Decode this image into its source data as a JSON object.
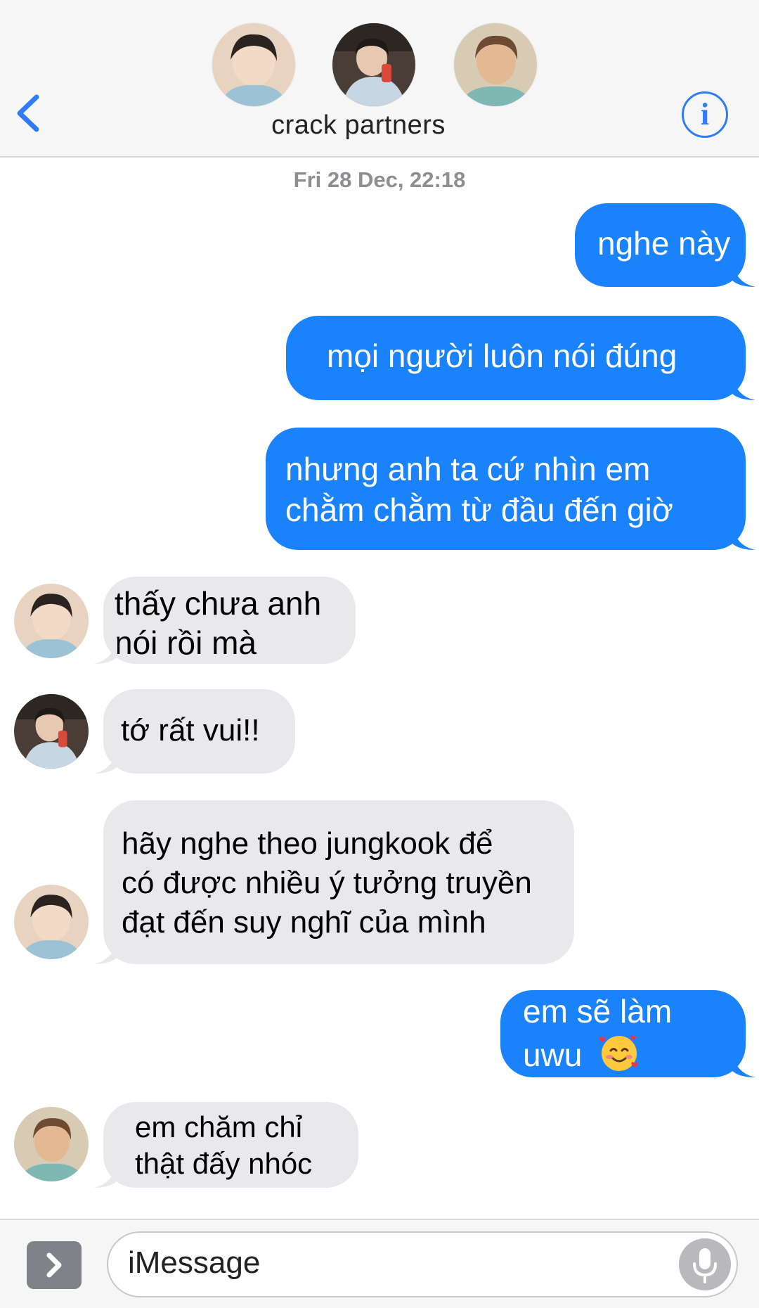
{
  "header": {
    "title": "crack partners",
    "back_icon": "chevron-left-icon",
    "info_icon": "info-icon",
    "info_glyph": "i",
    "accent_color": "#2f7cf6"
  },
  "timestamp": "Fri 28 Dec, 22:18",
  "messages": [
    {
      "from": "me",
      "text": "nghe này"
    },
    {
      "from": "me",
      "text": "mọi người luôn nói đúng"
    },
    {
      "from": "me",
      "lines": [
        "nhưng anh ta cứ nhìn em",
        "chằm chằm từ đầu đến giờ"
      ]
    },
    {
      "from": "contact-1",
      "lines": [
        "thấy chưa anh",
        "nói rồi mà"
      ]
    },
    {
      "from": "contact-2",
      "text": "tớ rất vui!!"
    },
    {
      "from": "contact-1",
      "lines": [
        "hãy nghe theo jungkook để",
        "có được nhiều ý tưởng truyền",
        "đạt đến suy nghĩ của mình"
      ]
    },
    {
      "from": "me",
      "lines": [
        "em sẽ làm",
        "uwu"
      ],
      "emoji": "smiling-face-with-hearts-icon"
    },
    {
      "from": "contact-3",
      "lines": [
        "em chăm chỉ",
        "thật đấy nhóc"
      ]
    }
  ],
  "colors": {
    "sent_bubble": "#1a82fb",
    "received_bubble": "#e9e9eb"
  },
  "composer": {
    "placeholder": "iMessage",
    "apps_icon": "chevron-right-icon",
    "mic_icon": "microphone-icon"
  }
}
